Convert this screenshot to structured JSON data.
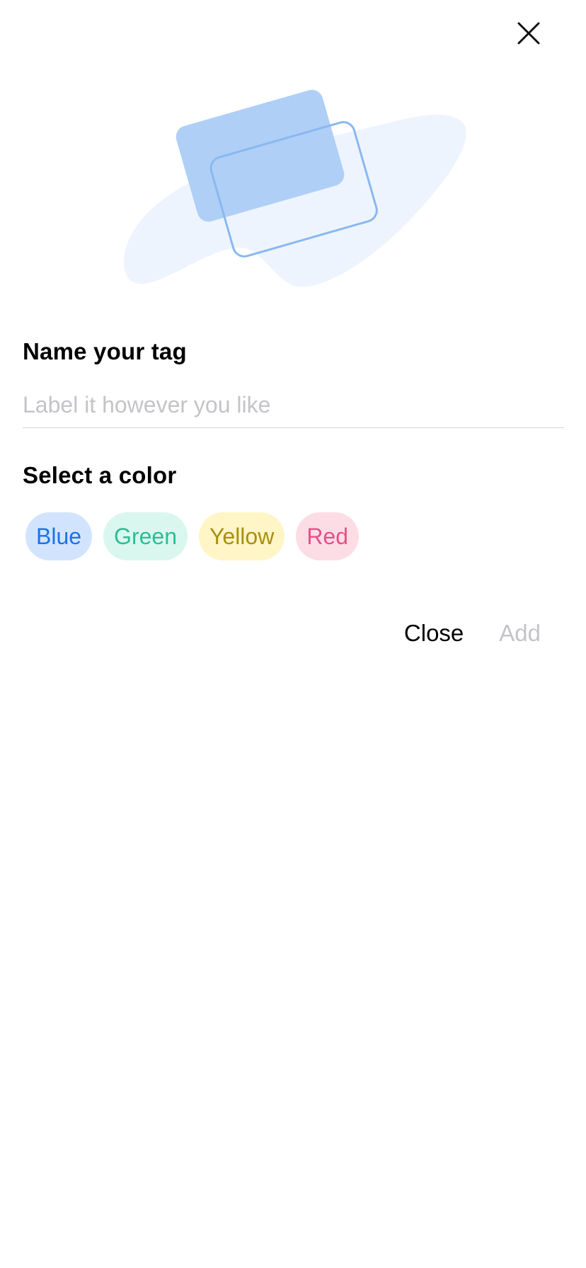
{
  "header": {
    "close_icon": "close-icon"
  },
  "illustration": {
    "icon": "tag-cards-illustration",
    "colors": {
      "blob": "#eef4fd",
      "card_filled": "#afcff7",
      "card_outline": "#8ab8f0"
    }
  },
  "name_section": {
    "title": "Name your tag",
    "input_value": "",
    "input_placeholder": "Label it however you like"
  },
  "color_section": {
    "title": "Select a color",
    "options": [
      {
        "label": "Blue",
        "bg": "#d2e4fd",
        "fg": "#1a73e8"
      },
      {
        "label": "Green",
        "bg": "#daf7ef",
        "fg": "#2dbd94"
      },
      {
        "label": "Yellow",
        "bg": "#fff5c6",
        "fg": "#a8900f"
      },
      {
        "label": "Red",
        "bg": "#fcdde6",
        "fg": "#e8508a"
      }
    ]
  },
  "actions": {
    "close_label": "Close",
    "add_label": "Add"
  }
}
